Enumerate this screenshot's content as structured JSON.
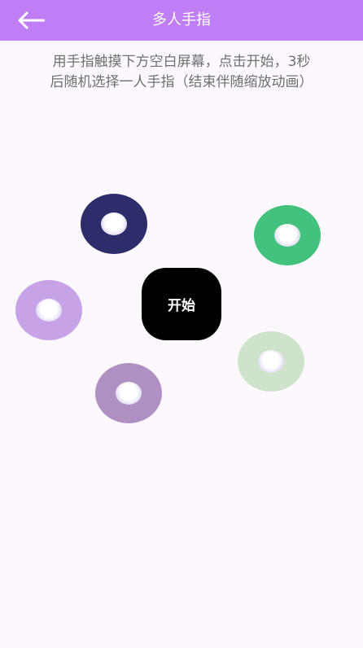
{
  "header": {
    "title": "多人手指",
    "back_icon": "arrow-left-icon"
  },
  "instructions": {
    "line1": "用手指触摸下方空白屏幕，点击开始，3秒",
    "line2": "后随机选择一人手指（结束伴随缩放动画）"
  },
  "start_button": {
    "label": "开始"
  },
  "fingers": [
    {
      "color": "#2d2d6b"
    },
    {
      "color": "#43c27d"
    },
    {
      "color": "#c7a2e6"
    },
    {
      "color": "#cfe2cb"
    },
    {
      "color": "#b08fc2"
    }
  ],
  "colors": {
    "header": "#bf7ef6",
    "background": "#fdf8fd"
  }
}
